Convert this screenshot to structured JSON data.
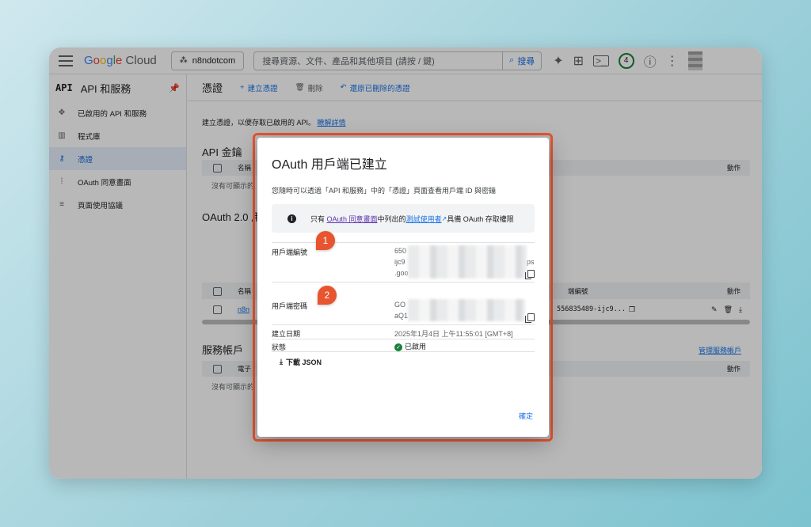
{
  "topbar": {
    "logo_text": "Google Cloud",
    "project": "n8ndotcom",
    "search_placeholder": "搜尋資源、文件、產品和其他項目 (請按 / 鍵)",
    "search_button": "搜尋",
    "notification_count": "4",
    "icons": [
      "menu-icon",
      "sparkle-icon",
      "gift-icon",
      "terminal-icon",
      "help-icon",
      "more-vert-icon"
    ]
  },
  "sidebar": {
    "title_abbr": "API",
    "title": "API 和服務",
    "items": [
      {
        "label": "已啟用的 API 和服務",
        "icon": "enabled-apis-icon",
        "active": false
      },
      {
        "label": "程式庫",
        "icon": "library-icon",
        "active": false
      },
      {
        "label": "憑證",
        "icon": "key-icon",
        "active": true
      },
      {
        "label": "OAuth 同意畫面",
        "icon": "consent-icon",
        "active": false
      },
      {
        "label": "頁面使用協議",
        "icon": "settings-list-icon",
        "active": false
      }
    ]
  },
  "main": {
    "title": "憑證",
    "actions": {
      "create": "建立憑證",
      "delete": "刪除",
      "restore": "還原已刪除的憑證"
    },
    "intro": "建立憑證，以便存取已啟用的 API。",
    "learn_more": "瞭解詳情",
    "api_keys": {
      "title": "API 金鑰",
      "col_name": "名稱",
      "col_actions": "動作",
      "empty": "沒有可顯示的"
    },
    "oauth": {
      "title": "OAuth 2.0 用",
      "col_name": "名稱",
      "col_id": "端編號",
      "col_actions": "動作",
      "row_name": "n8n",
      "row_id": "556835489-ijc9..."
    },
    "service_accounts": {
      "title": "服務帳戶",
      "manage": "管理服務帳戶",
      "col_email": "電子",
      "col_actions": "動作",
      "empty": "沒有可顯示的"
    }
  },
  "dialog": {
    "title": "OAuth 用戶端已建立",
    "description": "您隨時可以透過「API 和服務」中的「憑證」頁面查看用戶端 ID 與密鑰",
    "info": {
      "prefix": "只有",
      "link1": "OAuth 同意畫面",
      "middle": "中列出的",
      "link2": "測試使用者",
      "suffix": "具備 OAuth 存取權限"
    },
    "client_id_label": "用戶端編號",
    "client_id_parts": [
      "650",
      "ijc9",
      ".goo",
      "ps"
    ],
    "client_secret_label": "用戶端密碼",
    "client_secret_parts": [
      "GO",
      "aQ1"
    ],
    "created_label": "建立日期",
    "created_value": "2025年1月4日 上午11:55:01 [GMT+8]",
    "status_label": "狀態",
    "status_value": "已啟用",
    "download": "下載 JSON",
    "ok": "確定"
  },
  "markers": [
    "1",
    "2"
  ],
  "colors": {
    "accent": "#1a73e8",
    "highlight": "#e8542f",
    "success": "#188038"
  }
}
